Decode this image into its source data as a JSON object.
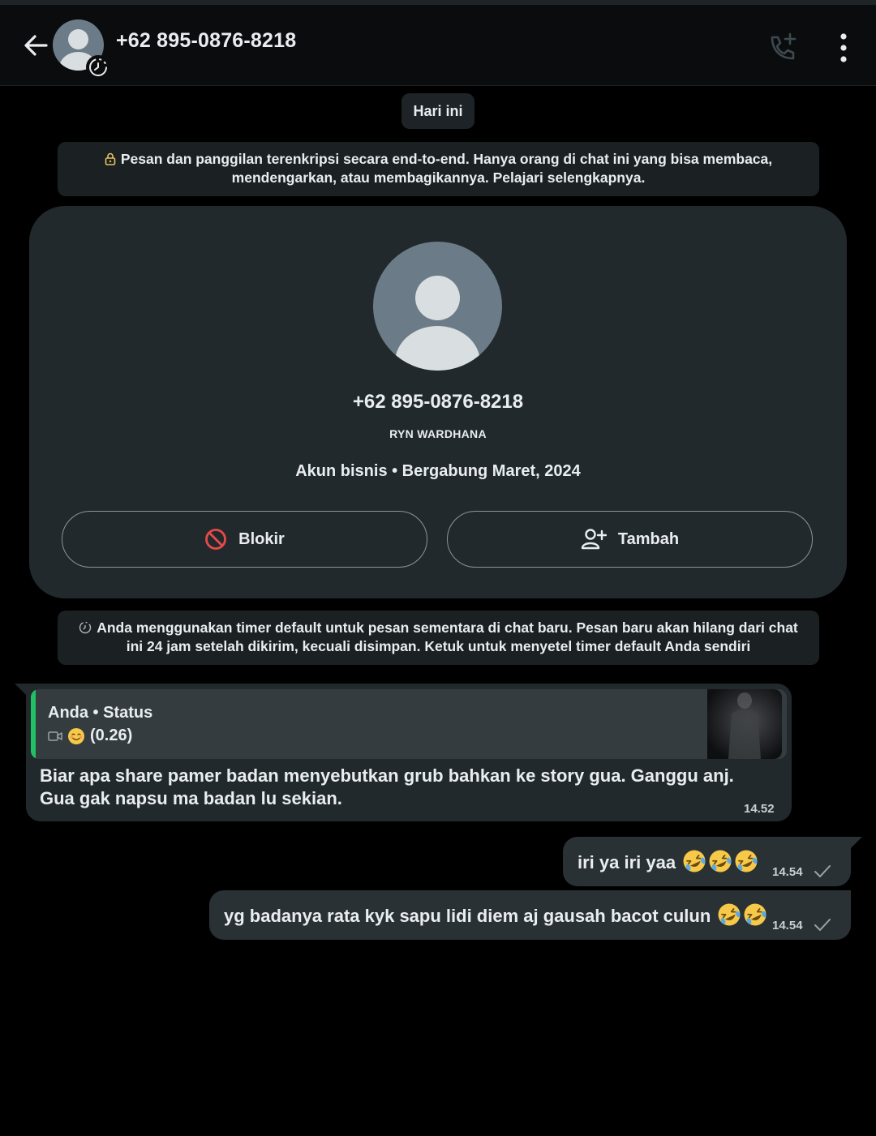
{
  "header": {
    "title": "+62 895-0876-8218",
    "icons": [
      "back-arrow-icon",
      "add-call-icon",
      "more-vert-icon"
    ]
  },
  "chat": {
    "date_chip": "Hari ini",
    "encryption_notice": "Pesan dan panggilan terenkripsi secara end-to-end. Hanya orang di chat ini yang bisa membaca, mendengarkan, atau membagikannya. Pelajari selengkapnya.",
    "profile_card": {
      "phone": "+62 895-0876-8218",
      "name": "RYN WARDHANA",
      "info": "Akun bisnis • Bergabung Maret, 2024",
      "block_label": "Blokir",
      "add_label": "Tambah"
    },
    "timer_notice": "Anda menggunakan timer default untuk pesan sementara di chat baru. Pesan baru akan hilang dari chat ini 24 jam setelah dikirim, kecuali disimpan. Ketuk untuk menyetel timer default Anda sendiri",
    "messages": [
      {
        "direction": "in",
        "reply": {
          "author": "Anda • Status",
          "text": "(0.26)"
        },
        "text": "Biar apa share pamer badan menyebutkan grub bahkan ke story gua. Ganggu anj. Gua gak napsu ma badan lu sekian.",
        "time": "14.52"
      },
      {
        "direction": "out",
        "text": "iri ya iri yaa",
        "time": "14.54",
        "emoji_count": 3
      },
      {
        "direction": "out",
        "text": "yg badanya rata kyk sapu lidi diem aj gausah bacot culun",
        "time": "14.54",
        "emoji_count": 2
      }
    ]
  },
  "colors": {
    "background": "#000000",
    "bubble_in": "#22292d",
    "bubble_out": "#2a3135",
    "accent_green": "#21c063",
    "block_red": "#e84a4a"
  }
}
